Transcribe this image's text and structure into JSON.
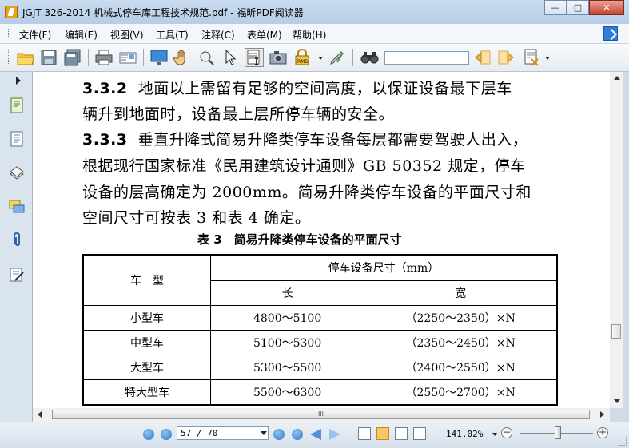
{
  "window": {
    "title": "JGJT 326-2014 机械式停车库工程技术规范.pdf - 福昕PDF阅读器",
    "controls": {
      "minimize": "—",
      "maximize": "□",
      "close": "✕"
    }
  },
  "menubar": {
    "items": [
      "文件(F)",
      "编辑(E)",
      "视图(V)",
      "工具(T)",
      "注释(C)",
      "表单(M)",
      "帮助(H)"
    ]
  },
  "toolbar": {
    "icons": [
      "open-icon",
      "save-icon",
      "save-as-icon",
      "print-icon",
      "email-icon",
      "screen-icon",
      "hand-icon",
      "zoom-tool-icon",
      "select-icon",
      "text-select-icon",
      "snapshot-icon",
      "rms-icon",
      "sign-icon",
      "find-icon"
    ],
    "rms_label": "RMS",
    "search": {
      "value": "",
      "placeholder": ""
    }
  },
  "sidebar": {
    "icons": [
      "bookmarks-icon",
      "pages-icon",
      "layers-icon",
      "comments-icon",
      "attachments-icon",
      "signatures-icon"
    ]
  },
  "document": {
    "para1_heading": "3.3.2",
    "para1_line1": "地面以上需留有足够的空间高度，以保证设备最下层车",
    "para1_line2": "辆升到地面时，设备最上层所停车辆的安全。",
    "para2_heading": "3.3.3",
    "para2_line1": "垂直升降式简易升降类停车设备每层都需要驾驶人出入，",
    "para2_line2": "根据现行国家标准《民用建筑设计通则》GB 50352 规定，停车",
    "para2_line3": "设备的层高确定为 2000mm。简易升降类停车设备的平面尺寸和",
    "para2_line4": "空间尺寸可按表 3 和表 4 确定。",
    "table_caption": "表 3　简易升降类停车设备的平面尺寸",
    "table": {
      "col_type": "车　型",
      "col_group": "停车设备尺寸（mm）",
      "col_length": "长",
      "col_width": "宽",
      "rows": [
        {
          "type": "小型车",
          "length": "4800～5100",
          "width": "（2250～2350）×N"
        },
        {
          "type": "中型车",
          "length": "5100～5300",
          "width": "（2350～2450）×N"
        },
        {
          "type": "大型车",
          "length": "5300～5500",
          "width": "（2400～2550）×N"
        },
        {
          "type": "特大型车",
          "length": "5500～6300",
          "width": "（2550～2700）×N"
        }
      ]
    }
  },
  "scrollbar": {
    "h_grip": "III"
  },
  "statusbar": {
    "page_field": "57 / 70",
    "zoom": "141.02%",
    "zoom_minus": "−",
    "zoom_plus": "+"
  }
}
